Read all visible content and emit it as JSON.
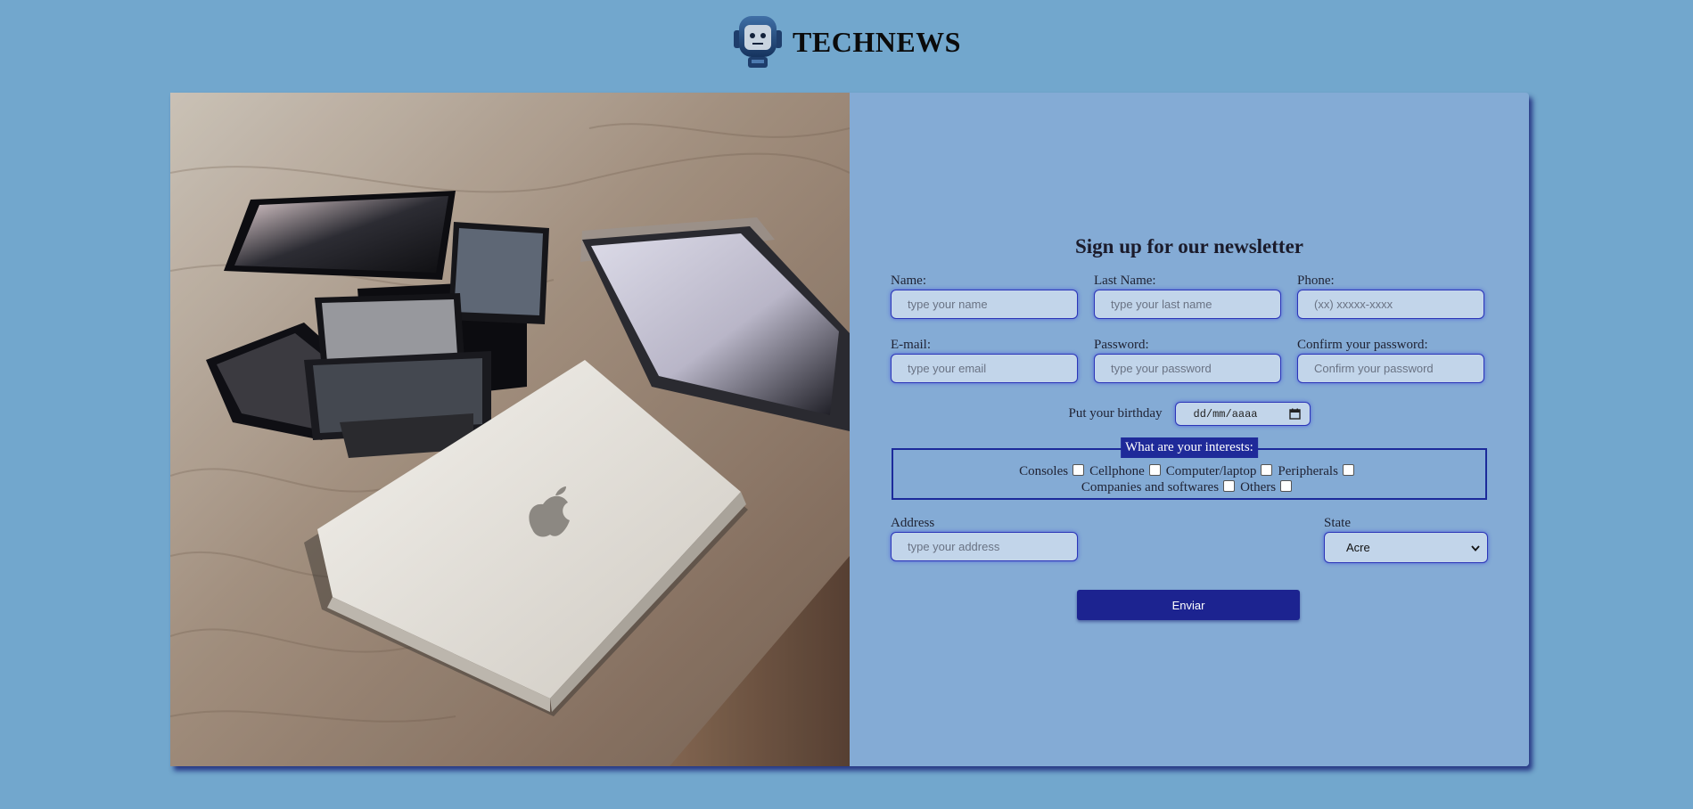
{
  "header": {
    "brand": "TECHNEWS",
    "logo_icon": "robot-icon"
  },
  "hero_image": {
    "description_icon": "devices-on-table-photo"
  },
  "form": {
    "title": "Sign up for our newsletter",
    "fields": {
      "name": {
        "label": "Name:",
        "placeholder": "type your name"
      },
      "last_name": {
        "label": "Last Name:",
        "placeholder": "type your last name"
      },
      "phone": {
        "label": "Phone:",
        "placeholder": "(xx) xxxxx-xxxx"
      },
      "email": {
        "label": "E-mail:",
        "placeholder": "type your email"
      },
      "password": {
        "label": "Password:",
        "placeholder": "type your password"
      },
      "confirm_password": {
        "label": "Confirm your password:",
        "placeholder": "Confirm your password"
      },
      "address": {
        "label": "Address",
        "placeholder": "type your address"
      }
    },
    "birthday": {
      "label": "Put your birthday",
      "value": "dd/mm/aaaa"
    },
    "interests": {
      "legend": "What are your interests:",
      "options": [
        "Consoles",
        "Cellphone",
        "Computer/laptop",
        "Peripherals",
        "Companies and softwares",
        "Others"
      ]
    },
    "state": {
      "label": "State",
      "selected": "Acre"
    },
    "submit_label": "Enviar"
  },
  "colors": {
    "page_background": "#72a7cd",
    "panel_background": "#84abd5",
    "accent": "#1c2390",
    "input_background": "#c2d5ea",
    "input_border": "#2b35b8"
  }
}
